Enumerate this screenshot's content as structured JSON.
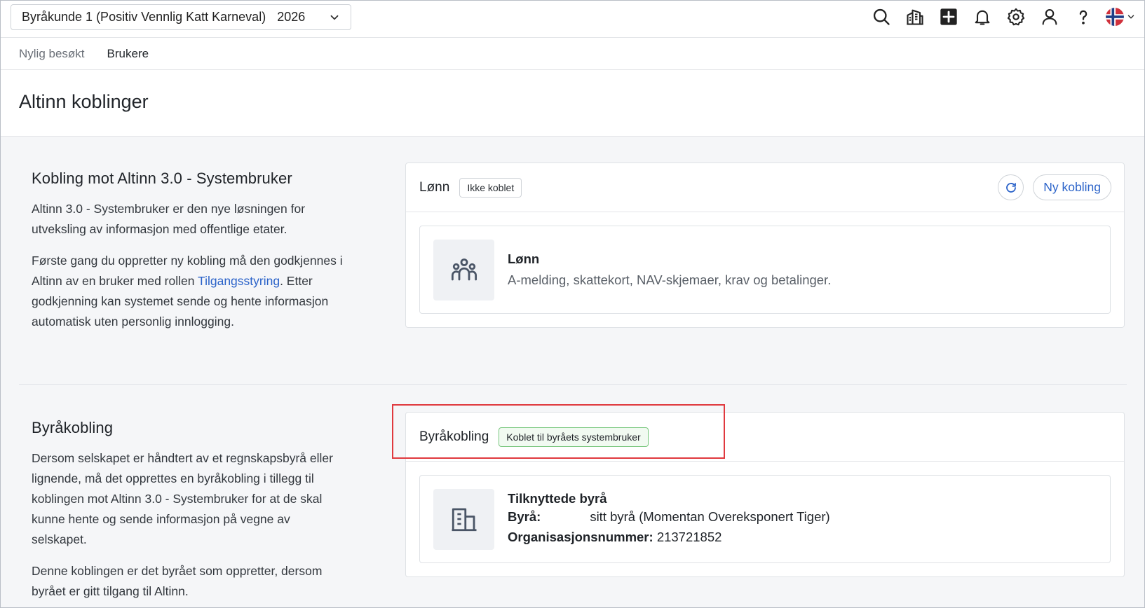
{
  "topbar": {
    "company": "Byråkunde 1 (Positiv Vennlig Katt Karneval)",
    "year": "2026",
    "icons": [
      "search-icon",
      "company-icon",
      "add-icon",
      "bell-icon",
      "gear-icon",
      "user-icon",
      "help-icon",
      "norway-flag-icon"
    ]
  },
  "subnav": {
    "items": [
      {
        "label": "Nylig besøkt"
      },
      {
        "label": "Brukere"
      }
    ]
  },
  "page": {
    "title": "Altinn koblinger"
  },
  "section1": {
    "heading": "Kobling mot Altinn 3.0 - Systembruker",
    "p1": "Altinn 3.0 - Systembruker er den nye løsningen for utveksling av informasjon med offentlige etater.",
    "p2_before": "Første gang du oppretter ny kobling må den godkjennes i Altinn av en bruker med rollen ",
    "p2_link": "Tilgangsstyring",
    "p2_after": ". Etter godkjenning kan systemet sende og hente informasjon automatisk uten personlig innlogging."
  },
  "card1": {
    "title": "Lønn",
    "status": "Ikke koblet",
    "new_button": "Ny kobling",
    "item_title": "Lønn",
    "item_desc": "A-melding, skattekort, NAV-skjemaer, krav og betalinger."
  },
  "section2": {
    "heading": "Byråkobling",
    "p1": "Dersom selskapet er håndtert av et regnskapsbyrå eller lignende, må det opprettes en byråkobling i tillegg til koblingen mot Altinn 3.0 - Systembruker for at de skal kunne hente og sende informasjon på vegne av selskapet.",
    "p2": "Denne koblingen er det byrået som oppretter, dersom byrået er gitt tilgang til Altinn."
  },
  "card2": {
    "title": "Byråkobling",
    "status": "Koblet til byråets systembruker",
    "item_title": "Tilknyttede byrå",
    "agency_label": "Byrå:",
    "agency_value": "sitt byrå (Momentan Overeksponert Tiger)",
    "org_label": "Organisasjonsnummer:",
    "org_value": "213721852"
  },
  "colors": {
    "link": "#2b63c9",
    "status_green_border": "#79c77e",
    "highlight": "#e0393e"
  }
}
